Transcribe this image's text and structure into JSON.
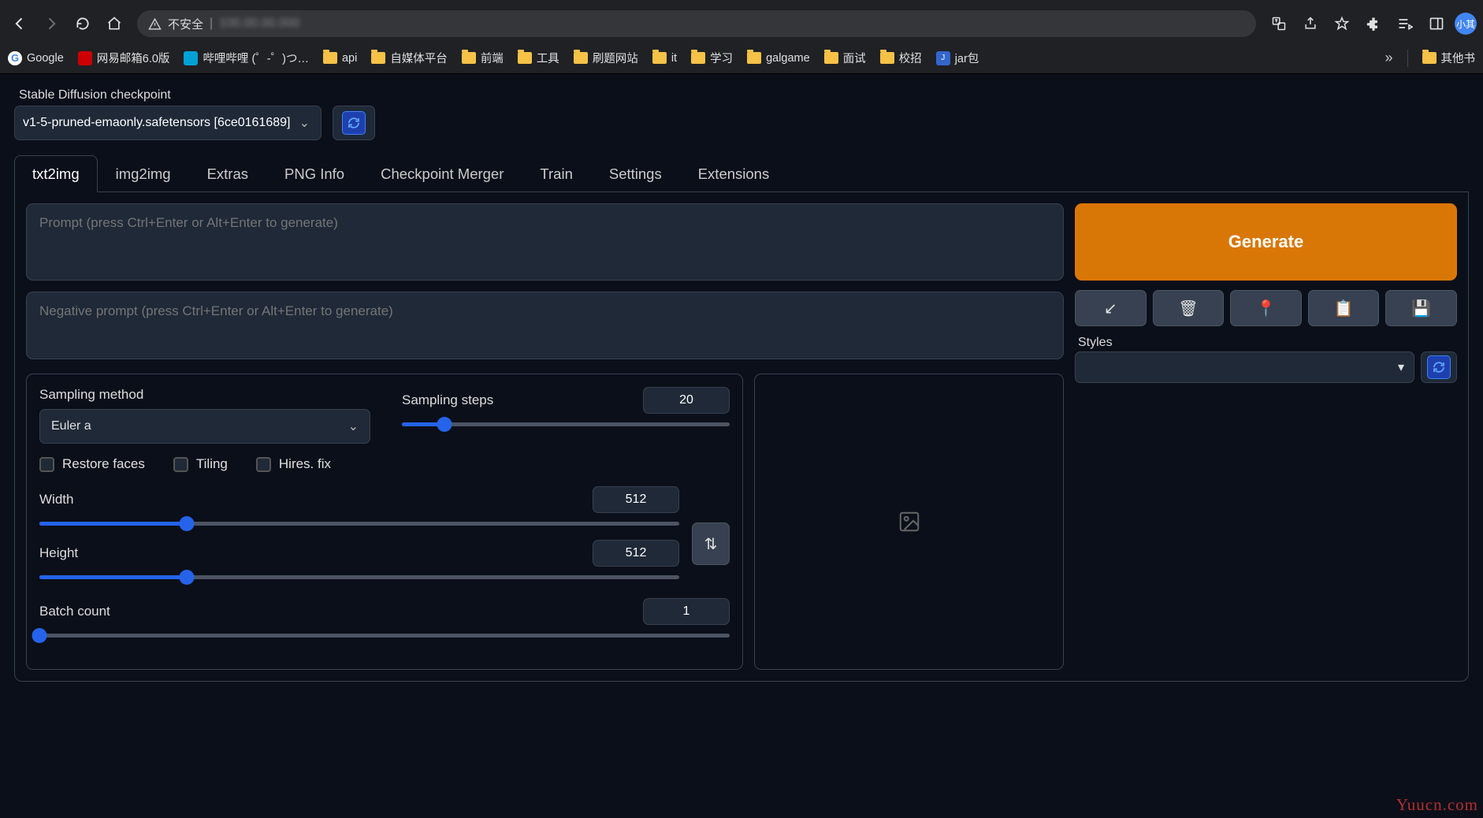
{
  "browser": {
    "address_prefix": "不安全",
    "bookmarks": [
      {
        "label": "Google",
        "iconClass": "bm-ico-g",
        "iconText": "G"
      },
      {
        "label": "网易邮箱6.0版",
        "iconClass": "bm-ico-163"
      },
      {
        "label": "哔哩哔哩 (゜-゜)つ…",
        "iconClass": "bm-ico-bili"
      },
      {
        "label": "api",
        "iconClass": "bm-folder"
      },
      {
        "label": "自媒体平台",
        "iconClass": "bm-folder"
      },
      {
        "label": "前端",
        "iconClass": "bm-folder"
      },
      {
        "label": "工具",
        "iconClass": "bm-folder"
      },
      {
        "label": "刷题网站",
        "iconClass": "bm-folder"
      },
      {
        "label": "it",
        "iconClass": "bm-folder"
      },
      {
        "label": "学习",
        "iconClass": "bm-folder"
      },
      {
        "label": "galgame",
        "iconClass": "bm-folder"
      },
      {
        "label": "面试",
        "iconClass": "bm-folder"
      },
      {
        "label": "校招",
        "iconClass": "bm-folder"
      },
      {
        "label": "jar包",
        "iconClass": "bm-ico-jar",
        "iconText": "J"
      }
    ],
    "bookmarks_right": {
      "label": "其他书"
    },
    "avatar_text": "小其"
  },
  "checkpoint": {
    "label": "Stable Diffusion checkpoint",
    "value": "v1-5-pruned-emaonly.safetensors [6ce0161689]"
  },
  "tabs": [
    "txt2img",
    "img2img",
    "Extras",
    "PNG Info",
    "Checkpoint Merger",
    "Train",
    "Settings",
    "Extensions"
  ],
  "active_tab": 0,
  "prompts": {
    "main_placeholder": "Prompt (press Ctrl+Enter or Alt+Enter to generate)",
    "neg_placeholder": "Negative prompt (press Ctrl+Enter or Alt+Enter to generate)"
  },
  "right": {
    "generate": "Generate",
    "styles_label": "Styles",
    "tool_icons": [
      "↙",
      "🗑",
      "📍",
      "📋",
      "💾"
    ]
  },
  "settings": {
    "sampling_method": {
      "label": "Sampling method",
      "value": "Euler a"
    },
    "sampling_steps": {
      "label": "Sampling steps",
      "value": "20",
      "pct": 13
    },
    "checks": [
      {
        "label": "Restore faces"
      },
      {
        "label": "Tiling"
      },
      {
        "label": "Hires. fix"
      }
    ],
    "width": {
      "label": "Width",
      "value": "512",
      "pct": 23
    },
    "height": {
      "label": "Height",
      "value": "512",
      "pct": 23
    },
    "batch_count": {
      "label": "Batch count",
      "value": "1",
      "pct": 0
    }
  },
  "watermark": "Yuucn.com"
}
